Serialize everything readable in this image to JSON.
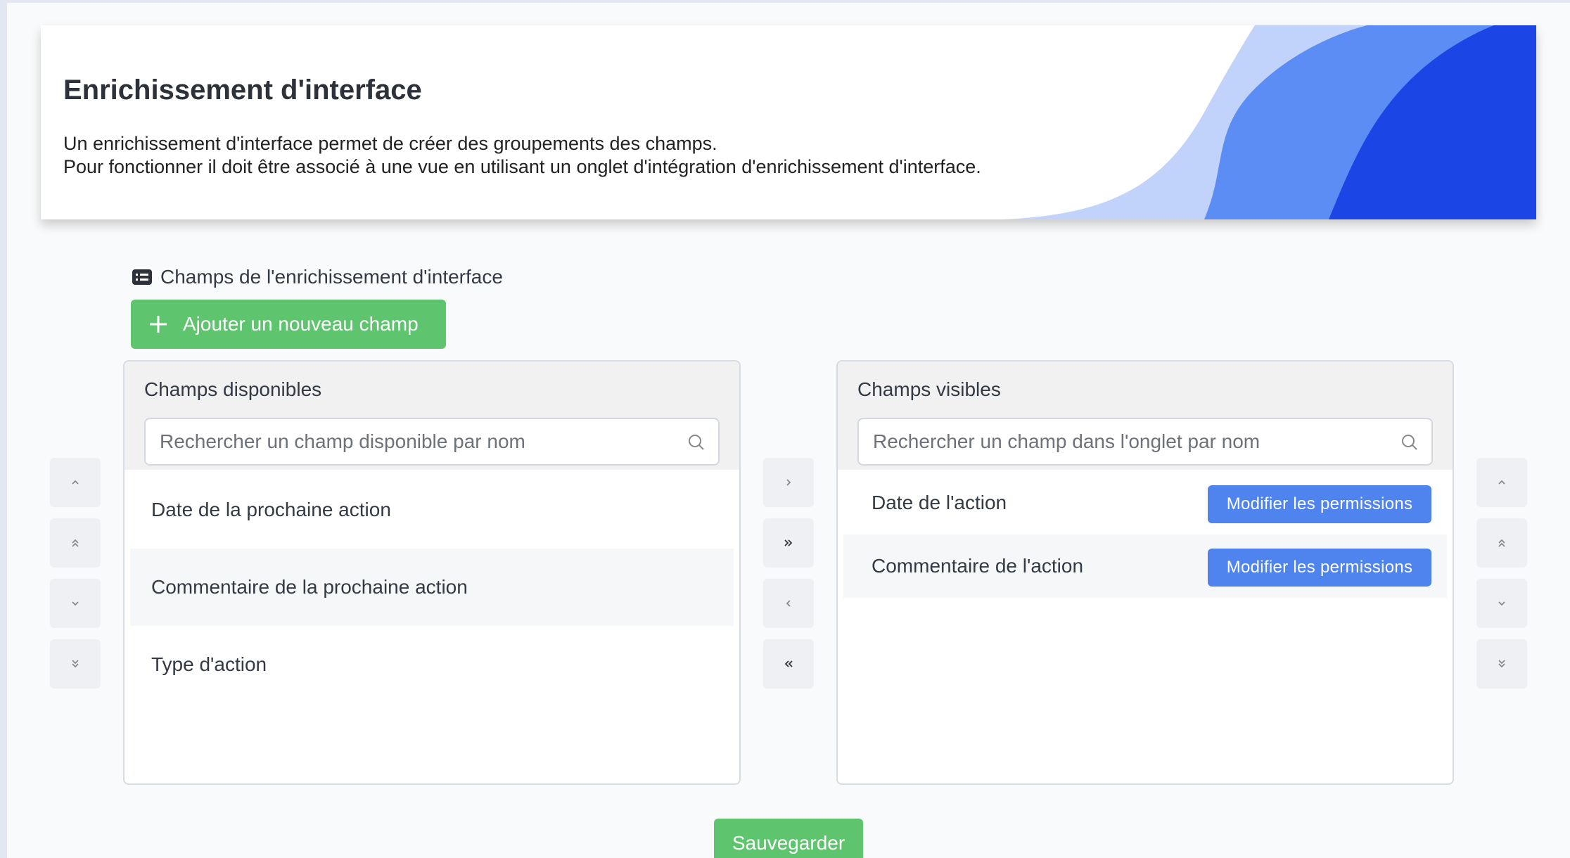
{
  "header": {
    "title": "Enrichissement d'interface",
    "description_line1": "Un enrichissement d'interface permet de créer des groupements des champs.",
    "description_line2": "Pour fonctionner il doit être associé à une vue en utilisant un onglet d'intégration d'enrichissement d'interface.",
    "wave_colors": [
      "#c1d3fa",
      "#5b8df5",
      "#1c45e6"
    ]
  },
  "section": {
    "label": "Champs de l'enrichissement d'interface",
    "icon": "list-card-icon"
  },
  "add_button": {
    "label": "Ajouter un nouveau champ",
    "icon": "plus-icon"
  },
  "available_panel": {
    "title": "Champs disponibles",
    "search_placeholder": "Rechercher un champ disponible par nom",
    "items": [
      {
        "label": "Date de la prochaine action"
      },
      {
        "label": "Commentaire de la prochaine action"
      },
      {
        "label": "Type d'action"
      }
    ]
  },
  "visible_panel": {
    "title": "Champs visibles",
    "search_placeholder": "Rechercher un champ dans l'onglet par nom",
    "permission_label": "Modifier les permissions",
    "items": [
      {
        "label": "Date de l'action"
      },
      {
        "label": "Commentaire de l'action"
      }
    ]
  },
  "save_button": {
    "label": "Sauvegarder"
  },
  "colors": {
    "green": "#5ec46e",
    "blue": "#4f83ed",
    "panel_header": "#f1f1f2"
  }
}
